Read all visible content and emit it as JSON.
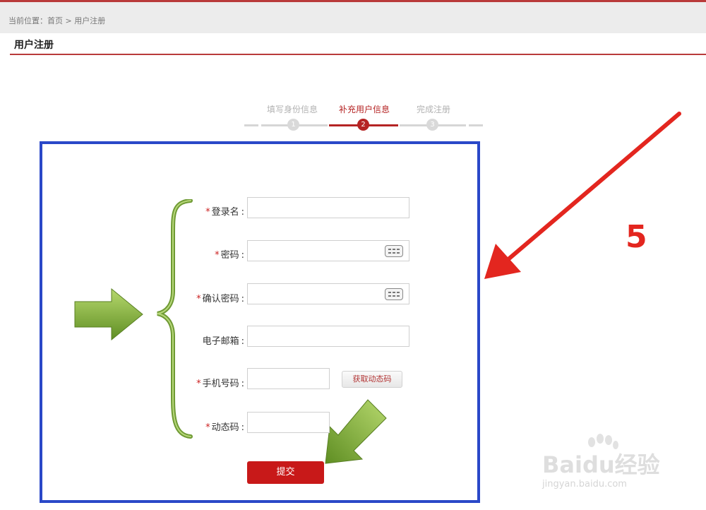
{
  "breadcrumb": {
    "prefix": "当前位置：",
    "home": "首页",
    "separator": ">",
    "current": "用户注册"
  },
  "page_title": "用户注册",
  "steps": [
    {
      "label": "填写身份信息",
      "number": "1",
      "state": "done"
    },
    {
      "label": "补充用户信息",
      "number": "2",
      "state": "active"
    },
    {
      "label": "完成注册",
      "number": "3",
      "state": "pending"
    }
  ],
  "form": {
    "login_name": {
      "label": "登录名",
      "required": true,
      "value": ""
    },
    "password": {
      "label": "密码",
      "required": true,
      "value": ""
    },
    "confirm_password": {
      "label": "确认密码",
      "required": true,
      "value": ""
    },
    "email": {
      "label": "电子邮箱",
      "required": false,
      "value": ""
    },
    "phone": {
      "label": "手机号码",
      "required": true,
      "value": ""
    },
    "otp_button": "获取动态码",
    "otp": {
      "label": "动态码",
      "required": true,
      "value": ""
    },
    "submit": "提交",
    "required_mark": "*",
    "colon": ":"
  },
  "annotation": {
    "step_number": "5"
  },
  "watermark": {
    "brand": "Baidu经验",
    "url": "jingyan.baidu.com"
  },
  "colors": {
    "accent": "#b93a3a",
    "submit": "#c81919",
    "panel_border": "#2a48c8",
    "annotation_red": "#e3261f",
    "arrow_green": "#7fae3a"
  },
  "icons": [
    "keyboard-icon",
    "keyboard-icon",
    "green-arrow-icon",
    "green-arrow-icon",
    "red-arrow-icon",
    "curly-brace"
  ]
}
